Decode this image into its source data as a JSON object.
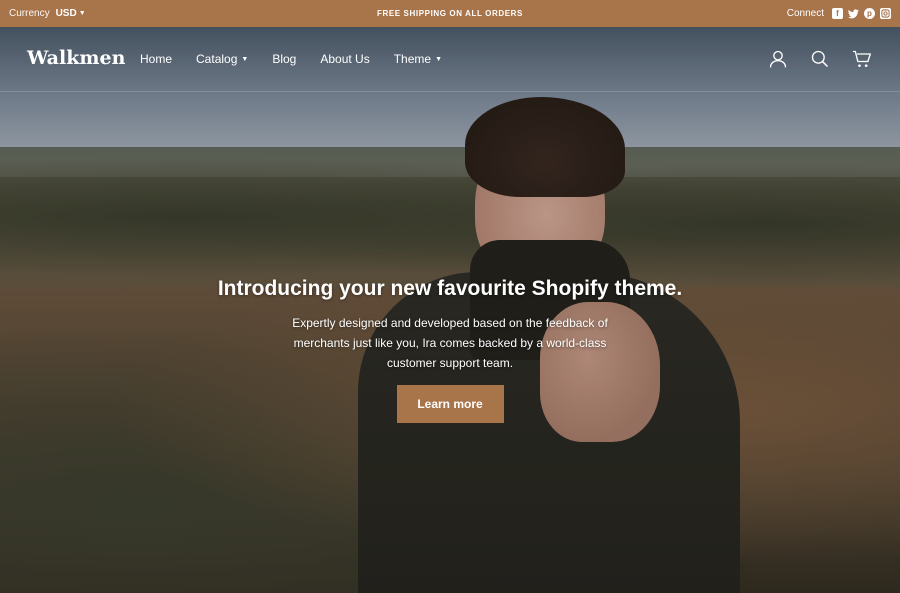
{
  "colors": {
    "accent": "#a8744a",
    "text_light": "#ffffff"
  },
  "topbar": {
    "currency_label": "Currency",
    "currency_value": "USD",
    "announcement": "FREE SHIPPING ON ALL ORDERS",
    "connect_label": "Connect",
    "social_icons": [
      "facebook-icon",
      "twitter-icon",
      "pinterest-icon",
      "instagram-icon"
    ]
  },
  "header": {
    "logo": "Walkmen",
    "nav": [
      {
        "label": "Home",
        "has_dropdown": false
      },
      {
        "label": "Catalog",
        "has_dropdown": true
      },
      {
        "label": "Blog",
        "has_dropdown": false
      },
      {
        "label": "About Us",
        "has_dropdown": false
      },
      {
        "label": "Theme",
        "has_dropdown": true
      }
    ],
    "icons": [
      "account-icon",
      "search-icon",
      "cart-icon"
    ]
  },
  "hero": {
    "title": "Introducing your new favourite Shopify theme.",
    "subtitle": "Expertly designed and developed based on the feedback of merchants just like you, Ira comes backed by a world-class customer support team.",
    "cta_label": "Learn more"
  }
}
